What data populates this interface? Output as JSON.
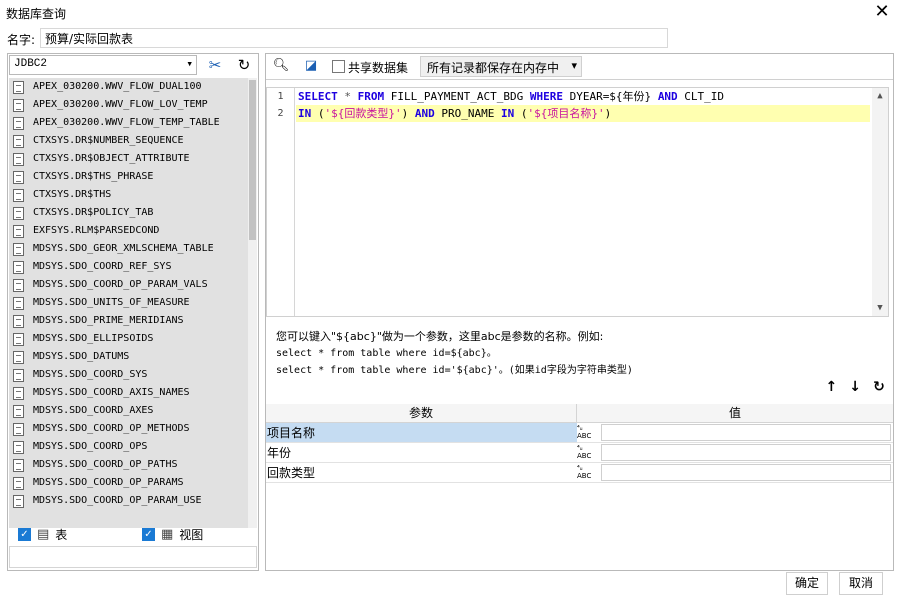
{
  "window": {
    "title": "数据库查询",
    "close_glyph": "✕"
  },
  "name": {
    "label": "名字:",
    "value": "预算/实际回款表"
  },
  "left": {
    "connection": "JDBC2",
    "tables": [
      "APEX_030200.WWV_FLOW_DUAL100",
      "APEX_030200.WWV_FLOW_LOV_TEMP",
      "APEX_030200.WWV_FLOW_TEMP_TABLE",
      "CTXSYS.DR$NUMBER_SEQUENCE",
      "CTXSYS.DR$OBJECT_ATTRIBUTE",
      "CTXSYS.DR$THS_PHRASE",
      "CTXSYS.DR$THS",
      "CTXSYS.DR$POLICY_TAB",
      "EXFSYS.RLM$PARSEDCOND",
      "MDSYS.SDO_GEOR_XMLSCHEMA_TABLE",
      "MDSYS.SDO_COORD_REF_SYS",
      "MDSYS.SDO_COORD_OP_PARAM_VALS",
      "MDSYS.SDO_UNITS_OF_MEASURE",
      "MDSYS.SDO_PRIME_MERIDIANS",
      "MDSYS.SDO_ELLIPSOIDS",
      "MDSYS.SDO_DATUMS",
      "MDSYS.SDO_COORD_SYS",
      "MDSYS.SDO_COORD_AXIS_NAMES",
      "MDSYS.SDO_COORD_AXES",
      "MDSYS.SDO_COORD_OP_METHODS",
      "MDSYS.SDO_COORD_OPS",
      "MDSYS.SDO_COORD_OP_PATHS",
      "MDSYS.SDO_COORD_OP_PARAMS",
      "MDSYS.SDO_COORD_OP_PARAM_USE"
    ],
    "table_label": "表",
    "view_label": "视图"
  },
  "right": {
    "shared_label": "共享数据集",
    "memory_option": "所有记录都保存在内存中",
    "line_numbers": [
      "1",
      "2"
    ],
    "help": [
      "您可以键入\"${abc}\"做为一个参数，这里abc是参数的名称。例如:",
      "select * from table where id=${abc}。",
      "select * from table where id='${abc}'。(如果id字段为字符串类型)"
    ],
    "params_header": {
      "param": "参数",
      "value": "值"
    },
    "params": [
      {
        "name": "项目名称",
        "value": ""
      },
      {
        "name": "年份",
        "value": ""
      },
      {
        "name": "回款类型",
        "value": ""
      }
    ],
    "type_icon_text": "ABC"
  },
  "buttons": {
    "ok": "确定",
    "cancel": "取消"
  }
}
